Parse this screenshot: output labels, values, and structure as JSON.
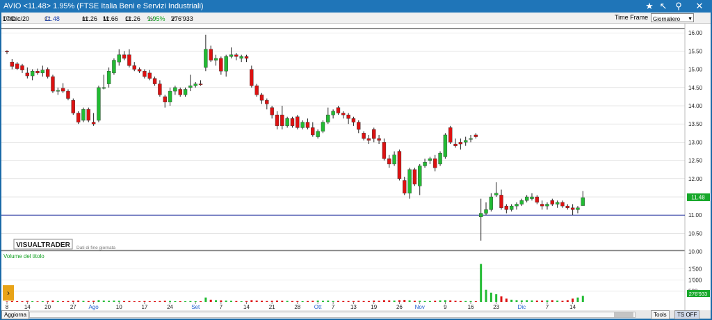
{
  "window": {
    "title": "AVIO <11.48> 1.95%  (FTSE Italia Beni e Servizi Industriali)",
    "icons": [
      "star-icon",
      "cursor-icon",
      "zoom-icon",
      "close-icon"
    ]
  },
  "infobar": {
    "date_label": "Data:",
    "date": "17/Dic/20",
    "close_label": "C:",
    "close": "11.48",
    "open_label": "m:",
    "open": "11.26",
    "high_label": "M:",
    "high": "11.66",
    "low_label": "O:",
    "low": "11.26",
    "pct_label": "%:",
    "pct": "1.95%",
    "volume_label": "V:",
    "volume": "276'933",
    "timeframe_label": "Time Frame",
    "timeframe_value": "Giornaliero"
  },
  "chart_labels": {
    "logo": "VISUALTRADER",
    "logo_note": "Dati di fine giornata",
    "volume_title": "Volume del titolo"
  },
  "statusbar": {
    "update_button": "Aggiorna",
    "tools_button": "Tools",
    "ts_button": "TS OFF"
  },
  "colors": {
    "up": "#22bb33",
    "down": "#dd1111",
    "reference_line": "#1a2a9a",
    "window": "#1f75b8"
  },
  "chart_data": {
    "type": "candlestick",
    "series": "AVIO",
    "price_axis": {
      "ylim": [
        10.05,
        16.1
      ],
      "ticks": [
        "16.00",
        "15.50",
        "15.00",
        "14.50",
        "14.00",
        "13.50",
        "13.00",
        "12.50",
        "12.00",
        "11.50",
        "11.00",
        "10.50",
        "10.00"
      ],
      "last_price_label": "11.48",
      "reference_line": 11.0
    },
    "volume_axis": {
      "ylim": [
        0,
        1900000
      ],
      "ticks": [
        "1'500",
        "1'000",
        "500"
      ],
      "last_volume_label": "276'933"
    },
    "x_ticks": [
      {
        "label": "8",
        "index": 0
      },
      {
        "label": "14",
        "index": 4
      },
      {
        "label": "20",
        "index": 8
      },
      {
        "label": "27",
        "index": 13
      },
      {
        "label": "Ago",
        "index": 17
      },
      {
        "label": "10",
        "index": 22
      },
      {
        "label": "17",
        "index": 27
      },
      {
        "label": "24",
        "index": 32
      },
      {
        "label": "Set",
        "index": 37
      },
      {
        "label": "7",
        "index": 42
      },
      {
        "label": "14",
        "index": 47
      },
      {
        "label": "21",
        "index": 52
      },
      {
        "label": "28",
        "index": 57
      },
      {
        "label": "Ott",
        "index": 61
      },
      {
        "label": "7",
        "index": 64
      },
      {
        "label": "13",
        "index": 68
      },
      {
        "label": "19",
        "index": 72
      },
      {
        "label": "26",
        "index": 77
      },
      {
        "label": "Nov",
        "index": 81
      },
      {
        "label": "9",
        "index": 86
      },
      {
        "label": "16",
        "index": 91
      },
      {
        "label": "23",
        "index": 96
      },
      {
        "label": "Dic",
        "index": 101
      },
      {
        "label": "7",
        "index": 106
      },
      {
        "label": "14",
        "index": 111
      }
    ],
    "month_ticks": [
      "Ago",
      "Set",
      "Ott",
      "Nov",
      "Dic"
    ],
    "candles": [
      [
        15.5,
        15.52,
        15.42,
        15.48,
        20000
      ],
      [
        15.2,
        15.28,
        15.0,
        15.08,
        40000
      ],
      [
        15.15,
        15.2,
        14.98,
        15.02,
        35000
      ],
      [
        15.1,
        15.15,
        14.9,
        14.98,
        30000
      ],
      [
        14.9,
        15.05,
        14.75,
        14.82,
        45000
      ],
      [
        14.82,
        15.0,
        14.7,
        14.95,
        30000
      ],
      [
        14.95,
        15.02,
        14.85,
        14.9,
        25000
      ],
      [
        14.9,
        15.1,
        14.8,
        14.98,
        30000
      ],
      [
        15.0,
        15.05,
        14.75,
        14.8,
        40000
      ],
      [
        14.8,
        14.85,
        14.35,
        14.4,
        60000
      ],
      [
        14.4,
        14.5,
        14.3,
        14.42,
        40000
      ],
      [
        14.48,
        14.62,
        14.35,
        14.4,
        30000
      ],
      [
        14.4,
        14.45,
        14.15,
        14.2,
        40000
      ],
      [
        14.15,
        14.2,
        13.75,
        13.8,
        50000
      ],
      [
        13.8,
        13.85,
        13.5,
        13.55,
        60000
      ],
      [
        13.6,
        13.95,
        13.55,
        13.9,
        45000
      ],
      [
        13.9,
        13.95,
        13.55,
        13.6,
        40000
      ],
      [
        13.55,
        13.8,
        13.45,
        13.5,
        50000
      ],
      [
        13.6,
        14.55,
        13.55,
        14.5,
        80000
      ],
      [
        14.5,
        14.85,
        14.45,
        14.5,
        60000
      ],
      [
        14.6,
        15.05,
        14.5,
        14.95,
        50000
      ],
      [
        14.9,
        15.3,
        14.85,
        15.25,
        60000
      ],
      [
        15.2,
        15.55,
        15.1,
        15.4,
        50000
      ],
      [
        15.4,
        15.5,
        15.25,
        15.3,
        40000
      ],
      [
        15.4,
        15.55,
        15.05,
        15.1,
        40000
      ],
      [
        15.1,
        15.2,
        14.95,
        15.0,
        30000
      ],
      [
        15.0,
        15.05,
        14.9,
        14.95,
        30000
      ],
      [
        14.95,
        15.0,
        14.75,
        14.8,
        40000
      ],
      [
        14.9,
        14.98,
        14.7,
        14.75,
        30000
      ],
      [
        14.75,
        14.8,
        14.55,
        14.6,
        35000
      ],
      [
        14.6,
        14.7,
        14.25,
        14.3,
        40000
      ],
      [
        14.25,
        14.3,
        13.95,
        14.1,
        50000
      ],
      [
        14.1,
        14.5,
        14.0,
        14.4,
        45000
      ],
      [
        14.4,
        14.55,
        14.3,
        14.5,
        35000
      ],
      [
        14.45,
        14.5,
        14.25,
        14.3,
        30000
      ],
      [
        14.3,
        14.5,
        14.25,
        14.45,
        30000
      ],
      [
        14.5,
        14.85,
        14.4,
        14.55,
        40000
      ],
      [
        14.55,
        14.65,
        14.5,
        14.6,
        30000
      ],
      [
        14.6,
        14.7,
        14.55,
        14.58,
        30000
      ],
      [
        15.05,
        15.95,
        14.95,
        15.55,
        200000
      ],
      [
        15.55,
        15.65,
        15.2,
        15.25,
        100000
      ],
      [
        15.25,
        15.4,
        15.1,
        15.3,
        80000
      ],
      [
        15.3,
        15.35,
        14.85,
        14.95,
        70000
      ],
      [
        14.95,
        15.4,
        14.8,
        15.35,
        60000
      ],
      [
        15.35,
        15.6,
        15.3,
        15.4,
        50000
      ],
      [
        15.4,
        15.45,
        15.25,
        15.35,
        40000
      ],
      [
        15.3,
        15.4,
        15.2,
        15.35,
        30000
      ],
      [
        15.35,
        15.4,
        15.2,
        15.3,
        40000
      ],
      [
        15.0,
        15.1,
        14.5,
        14.55,
        80000
      ],
      [
        14.55,
        14.6,
        14.25,
        14.3,
        60000
      ],
      [
        14.3,
        14.35,
        14.05,
        14.15,
        50000
      ],
      [
        14.15,
        14.2,
        13.9,
        14.05,
        40000
      ],
      [
        13.95,
        14.0,
        13.65,
        13.75,
        50000
      ],
      [
        13.75,
        13.85,
        13.35,
        13.45,
        60000
      ],
      [
        13.75,
        14.0,
        13.35,
        13.45,
        50000
      ],
      [
        13.45,
        13.7,
        13.4,
        13.65,
        45000
      ],
      [
        13.65,
        13.7,
        13.4,
        13.45,
        40000
      ],
      [
        13.7,
        13.75,
        13.35,
        13.4,
        40000
      ],
      [
        13.4,
        13.6,
        13.35,
        13.55,
        35000
      ],
      [
        13.55,
        13.65,
        13.35,
        13.4,
        40000
      ],
      [
        13.4,
        13.55,
        13.15,
        13.2,
        50000
      ],
      [
        13.15,
        13.35,
        13.1,
        13.3,
        60000
      ],
      [
        13.3,
        13.6,
        13.25,
        13.55,
        50000
      ],
      [
        13.55,
        13.95,
        13.5,
        13.75,
        60000
      ],
      [
        13.75,
        13.9,
        13.65,
        13.85,
        40000
      ],
      [
        13.95,
        14.0,
        13.75,
        13.8,
        45000
      ],
      [
        13.8,
        13.85,
        13.65,
        13.75,
        40000
      ],
      [
        13.75,
        13.8,
        13.5,
        13.65,
        40000
      ],
      [
        13.65,
        13.7,
        13.45,
        13.55,
        40000
      ],
      [
        13.55,
        13.6,
        13.25,
        13.35,
        50000
      ],
      [
        13.25,
        13.3,
        13.05,
        13.1,
        40000
      ],
      [
        13.1,
        13.2,
        12.95,
        13.05,
        40000
      ],
      [
        13.35,
        13.4,
        13.0,
        13.1,
        60000
      ],
      [
        13.1,
        13.2,
        12.95,
        13.05,
        50000
      ],
      [
        13.0,
        13.1,
        12.5,
        12.55,
        80000
      ],
      [
        12.55,
        12.65,
        12.3,
        12.4,
        70000
      ],
      [
        12.4,
        12.75,
        12.35,
        12.65,
        60000
      ],
      [
        12.75,
        12.8,
        11.95,
        12.0,
        80000
      ],
      [
        11.95,
        12.05,
        11.55,
        11.6,
        90000
      ],
      [
        11.6,
        12.3,
        11.45,
        12.25,
        70000
      ],
      [
        12.25,
        12.3,
        11.8,
        11.85,
        50000
      ],
      [
        11.8,
        12.4,
        11.55,
        12.35,
        50000
      ],
      [
        12.35,
        12.55,
        12.3,
        12.45,
        40000
      ],
      [
        12.5,
        12.6,
        12.4,
        12.55,
        40000
      ],
      [
        12.55,
        12.65,
        12.2,
        12.3,
        50000
      ],
      [
        12.4,
        12.75,
        12.35,
        12.7,
        70000
      ],
      [
        12.6,
        13.25,
        12.55,
        13.2,
        80000
      ],
      [
        13.4,
        13.45,
        12.95,
        13.0,
        70000
      ],
      [
        12.95,
        13.1,
        12.85,
        12.9,
        50000
      ],
      [
        13.0,
        13.1,
        12.8,
        12.95,
        40000
      ],
      [
        13.0,
        13.15,
        12.9,
        13.05,
        40000
      ],
      [
        13.1,
        13.2,
        13.0,
        13.1,
        40000
      ],
      [
        13.2,
        13.25,
        13.1,
        13.15,
        30000
      ],
      [
        10.95,
        11.45,
        10.3,
        11.05,
        1730000
      ],
      [
        11.05,
        11.35,
        11.0,
        11.15,
        550000
      ],
      [
        11.15,
        11.6,
        11.1,
        11.5,
        420000
      ],
      [
        11.55,
        11.9,
        11.5,
        11.6,
        350000
      ],
      [
        11.55,
        11.7,
        11.15,
        11.2,
        250000
      ],
      [
        11.25,
        11.3,
        11.05,
        11.15,
        150000
      ],
      [
        11.15,
        11.3,
        11.1,
        11.25,
        100000
      ],
      [
        11.25,
        11.35,
        11.15,
        11.3,
        80000
      ],
      [
        11.3,
        11.45,
        11.25,
        11.4,
        70000
      ],
      [
        11.4,
        11.55,
        11.35,
        11.5,
        80000
      ],
      [
        11.45,
        11.6,
        11.4,
        11.5,
        70000
      ],
      [
        11.5,
        11.55,
        11.3,
        11.35,
        60000
      ],
      [
        11.3,
        11.4,
        11.15,
        11.25,
        60000
      ],
      [
        11.25,
        11.35,
        11.15,
        11.3,
        70000
      ],
      [
        11.4,
        11.45,
        11.25,
        11.3,
        80000
      ],
      [
        11.3,
        11.4,
        11.2,
        11.35,
        60000
      ],
      [
        11.35,
        11.4,
        11.2,
        11.25,
        50000
      ],
      [
        11.25,
        11.3,
        11.15,
        11.2,
        80000
      ],
      [
        11.2,
        11.3,
        11.0,
        11.15,
        150000
      ],
      [
        11.15,
        11.25,
        11.05,
        11.2,
        200000
      ],
      [
        11.26,
        11.66,
        11.26,
        11.48,
        276933
      ]
    ]
  }
}
